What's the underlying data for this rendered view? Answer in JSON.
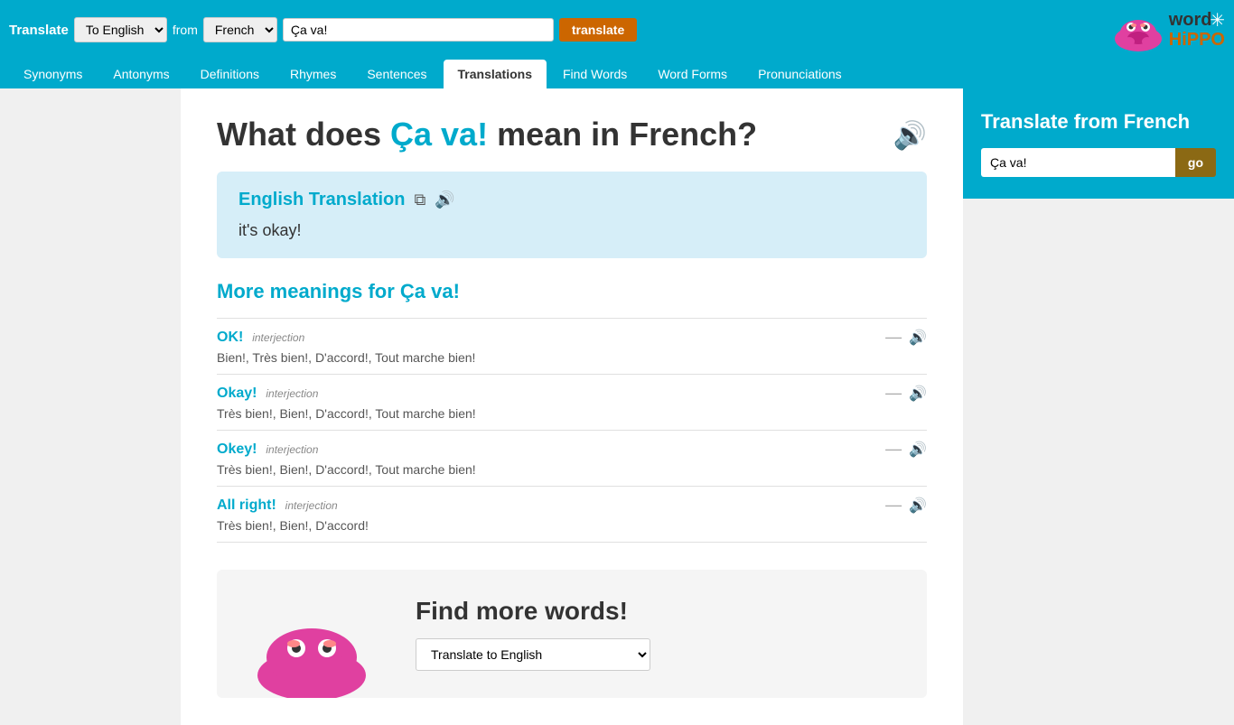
{
  "topbar": {
    "translate_label": "Translate",
    "to_option": "To English",
    "from_label": "from",
    "from_option": "French",
    "search_value": "Ça va!",
    "translate_btn": "translate"
  },
  "logo": {
    "word": "word",
    "hippo": "HiPPO"
  },
  "nav": {
    "items": [
      {
        "id": "synonyms",
        "label": "Synonyms",
        "active": false
      },
      {
        "id": "antonyms",
        "label": "Antonyms",
        "active": false
      },
      {
        "id": "definitions",
        "label": "Definitions",
        "active": false
      },
      {
        "id": "rhymes",
        "label": "Rhymes",
        "active": false
      },
      {
        "id": "sentences",
        "label": "Sentences",
        "active": false
      },
      {
        "id": "translations",
        "label": "Translations",
        "active": true
      },
      {
        "id": "find-words",
        "label": "Find Words",
        "active": false
      },
      {
        "id": "word-forms",
        "label": "Word Forms",
        "active": false
      },
      {
        "id": "pronunciations",
        "label": "Pronunciations",
        "active": false
      }
    ]
  },
  "page": {
    "title_prefix": "What does ",
    "title_word": "Ça va!",
    "title_suffix": " mean in French?",
    "translation_section_label": "English Translation",
    "translation_result": "it's okay!",
    "more_meanings_title": "More meanings for Ça va!"
  },
  "meanings": [
    {
      "word": "OK!",
      "type": "interjection",
      "synonyms": "Bien!, Très bien!, D'accord!, Tout marche bien!"
    },
    {
      "word": "Okay!",
      "type": "interjection",
      "synonyms": "Très bien!, Bien!, D'accord!, Tout marche bien!"
    },
    {
      "word": "Okey!",
      "type": "interjection",
      "synonyms": "Très bien!, Bien!, D'accord!, Tout marche bien!"
    },
    {
      "word": "All right!",
      "type": "interjection",
      "synonyms": "Très bien!, Bien!, D'accord!"
    }
  ],
  "find_more": {
    "title": "Find more words!",
    "select_default": "Translate to English"
  },
  "sidebar": {
    "translate_title": "Translate from French",
    "input_value": "Ça va!",
    "go_btn": "go"
  }
}
